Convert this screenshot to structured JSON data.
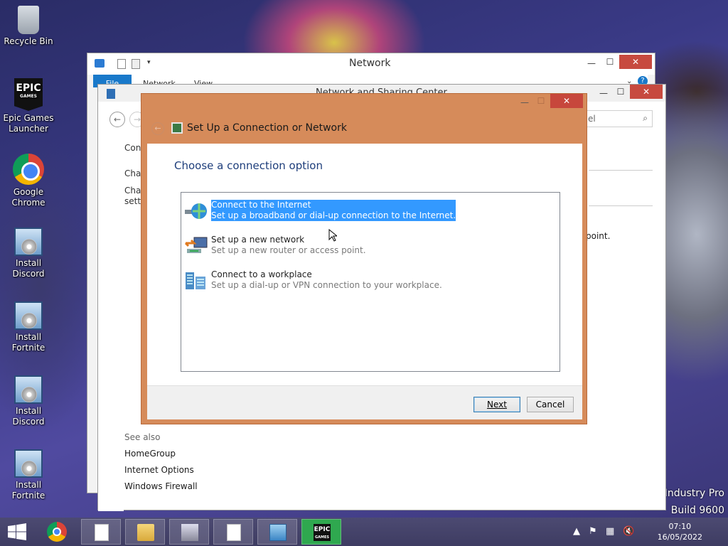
{
  "desktop": {
    "icons": [
      {
        "label": "Recycle Bin"
      },
      {
        "label": "Epic Games Launcher",
        "logo": "EPIC",
        "logo_sub": "GAMES"
      },
      {
        "label": "Google Chrome"
      },
      {
        "label": "Install Discord"
      },
      {
        "label": "Install Fortnite"
      },
      {
        "label": "Install Discord"
      },
      {
        "label": "Install Fortnite"
      }
    ],
    "watermark": {
      "line1": "Industry Pro",
      "line2": "Build 9600"
    }
  },
  "network_window": {
    "title": "Network",
    "ribbon_tabs": [
      "File",
      "Network",
      "View"
    ]
  },
  "nsc_window": {
    "title": "Network and Sharing Center",
    "search_placeholder": "el",
    "left_nav": [
      "Conf",
      "Char",
      "Char",
      "setti"
    ],
    "right_fragment": "point.",
    "see_also_header": "See also",
    "see_also_links": [
      "HomeGroup",
      "Internet Options",
      "Windows Firewall"
    ]
  },
  "wizard": {
    "title": "Set Up a Connection or Network",
    "heading": "Choose a connection option",
    "options": [
      {
        "title": "Connect to the Internet",
        "desc": "Set up a broadband or dial-up connection to the Internet.",
        "selected": true
      },
      {
        "title": "Set up a new network",
        "desc": "Set up a new router or access point.",
        "selected": false
      },
      {
        "title": "Connect to a workplace",
        "desc": "Set up a dial-up or VPN connection to your workplace.",
        "selected": false
      }
    ],
    "next_label": "Next",
    "cancel_label": "Cancel"
  },
  "taskbar": {
    "epic_label": "EPIC",
    "epic_sub": "GAMES",
    "time": "07:10",
    "date": "16/05/2022"
  },
  "colors": {
    "wizard_frame": "#d68b5a",
    "selection": "#3399ff",
    "heading": "#1e3e7b",
    "taskbar": "#4c4a72"
  }
}
